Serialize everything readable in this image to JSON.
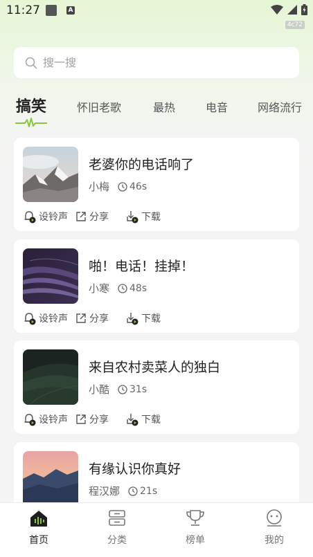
{
  "status_bar": {
    "time": "11:27",
    "badge": "4c72"
  },
  "search": {
    "placeholder": "搜一搜"
  },
  "tabs": [
    {
      "label": "搞笑",
      "active": true
    },
    {
      "label": "怀旧老歌"
    },
    {
      "label": "最热"
    },
    {
      "label": "电音"
    },
    {
      "label": "网络流行"
    }
  ],
  "actions": {
    "ringtone": "设铃声",
    "share": "分享",
    "download": "下载"
  },
  "songs": [
    {
      "title": "老婆你的电话响了",
      "artist": "小梅",
      "duration": "46s",
      "thumb": "mountain-snow"
    },
    {
      "title": "啪！电话！挂掉！",
      "artist": "小寒",
      "duration": "48s",
      "thumb": "purple-waves"
    },
    {
      "title": "来自农村卖菜人的独白",
      "artist": "小酷",
      "duration": "31s",
      "thumb": "green-field"
    },
    {
      "title": "有缘认识你真好",
      "artist": "程汉娜",
      "duration": "21s",
      "thumb": "sunset-mountains"
    }
  ],
  "bottom_nav": [
    {
      "label": "首页",
      "icon": "home-icon",
      "active": true
    },
    {
      "label": "分类",
      "icon": "category-icon"
    },
    {
      "label": "榜单",
      "icon": "trophy-icon"
    },
    {
      "label": "我的",
      "icon": "profile-icon"
    }
  ],
  "colors": {
    "accent_green": "#8cc63f",
    "active_black": "#222222"
  }
}
